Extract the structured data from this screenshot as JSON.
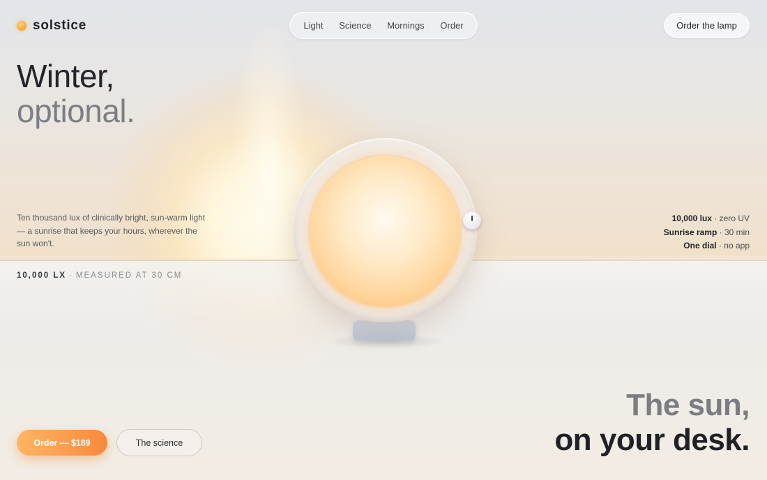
{
  "brand": {
    "name": "solstice",
    "icon": "sun-dot-icon"
  },
  "nav": {
    "items": [
      "Light",
      "Science",
      "Mornings",
      "Order"
    ]
  },
  "header": {
    "cta_label": "Order the lamp"
  },
  "hero": {
    "headline_line1": "Winter,",
    "headline_line2": "optional.",
    "lede": "Ten thousand lux of clinically bright, sun-warm light — a sunrise that keeps your hours, wherever the sun won't.",
    "measure_strong": "10,000 LX",
    "measure_sep": "·",
    "measure_rest": "MEASURED AT 30 CM"
  },
  "specs": [
    {
      "label": "10,000 lux",
      "value": " · zero UV"
    },
    {
      "label": "Sunrise ramp",
      "value": " · 30 min"
    },
    {
      "label": "One dial",
      "value": " · no app"
    }
  ],
  "tagline": {
    "line1": "The sun,",
    "line2": "on your desk."
  },
  "actions": {
    "order_label": "Order — $189",
    "science_label": "The science"
  },
  "colors": {
    "accent_start": "#ffb562",
    "accent_end": "#f8893d",
    "text_dark": "#1f2126",
    "text_muted": "#7d7f84"
  }
}
